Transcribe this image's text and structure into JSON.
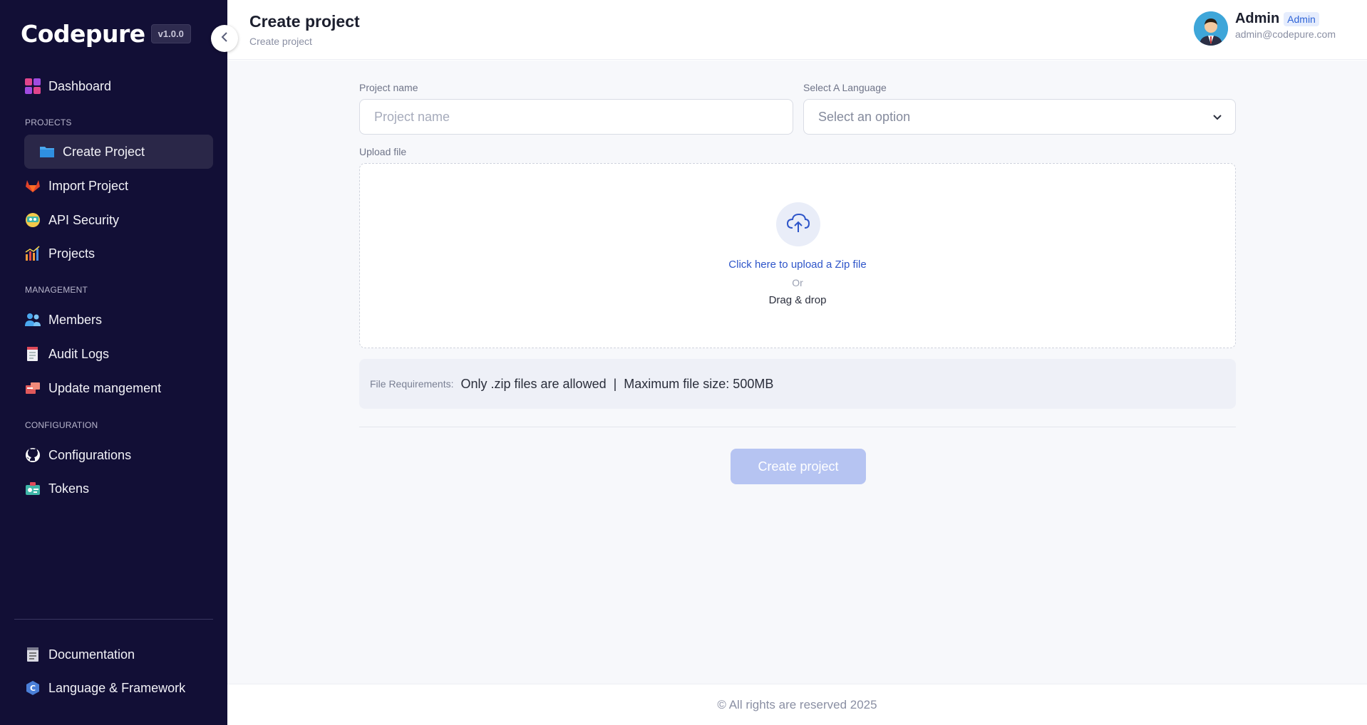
{
  "sidebar": {
    "logo": "Codepure",
    "version": "v1.0.0",
    "items": [
      {
        "label": "Dashboard",
        "icon": "dashboard-icon"
      },
      {
        "label": "Create Project",
        "icon": "folder-icon",
        "active": true
      },
      {
        "label": "Import Project",
        "icon": "gitlab-icon"
      },
      {
        "label": "API Security",
        "icon": "api-security-icon"
      },
      {
        "label": "Projects",
        "icon": "bar-chart-icon"
      },
      {
        "label": "Members",
        "icon": "members-icon"
      },
      {
        "label": "Audit Logs",
        "icon": "audit-log-icon"
      },
      {
        "label": "Update mangement",
        "icon": "update-icon"
      },
      {
        "label": "Configurations",
        "icon": "github-icon"
      },
      {
        "label": "Tokens",
        "icon": "token-icon"
      },
      {
        "label": "Documentation",
        "icon": "document-icon"
      },
      {
        "label": "Language & Framework",
        "icon": "language-framework-icon"
      }
    ],
    "sections": {
      "projects": "PROJECTS",
      "management": "MANAGEMENT",
      "configuration": "CONFIGURATION"
    }
  },
  "header": {
    "title": "Create project",
    "breadcrumb": "Create project"
  },
  "user": {
    "name": "Admin",
    "role": "Admin",
    "email": "admin@codepure.com"
  },
  "form": {
    "project_name_label": "Project name",
    "project_name_placeholder": "Project name",
    "language_label": "Select A Language",
    "language_value": "Select an option",
    "upload_label": "Upload file",
    "upload_link": "Click here to upload a Zip file",
    "upload_or": "Or",
    "upload_drag": "Drag & drop",
    "requirements_label": "File Requirements:",
    "requirement_1": "Only .zip files are allowed",
    "requirement_sep": "|",
    "requirement_2": "Maximum file size: 500MB",
    "submit_label": "Create project"
  },
  "footer": {
    "text": "© All rights are reserved 2025"
  },
  "colors": {
    "sidebar_bg": "#120f36",
    "accent": "#2e55c9",
    "button_disabled": "#b6c4f2"
  }
}
